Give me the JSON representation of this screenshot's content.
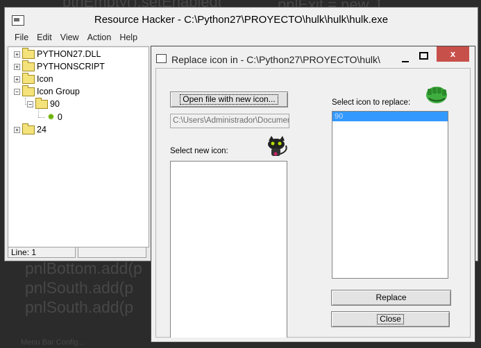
{
  "background_code": [
    "btnEmpty().setEnabled(",
    "pnlExit = new J",
    "pnlBottom.add(p",
    "pnlSouth.add(p",
    "pnlSouth.add(p",
    "Menu Bar Config..."
  ],
  "main_window": {
    "title": "Resource Hacker  -  C:\\Python27\\PROYECTO\\hulk\\hulk\\hulk.exe",
    "menu": [
      "File",
      "Edit",
      "View",
      "Action",
      "Help"
    ],
    "tree": [
      {
        "label": "PYTHON27.DLL",
        "expander": "+"
      },
      {
        "label": "PYTHONSCRIPT",
        "expander": "+"
      },
      {
        "label": "Icon",
        "expander": "+"
      },
      {
        "label": "Icon Group",
        "expander": "−"
      },
      {
        "label": "90",
        "expander": "−"
      },
      {
        "label": "0",
        "expander": ""
      },
      {
        "label": "24",
        "expander": "+"
      }
    ],
    "status": {
      "line": "Line: 1",
      "cell2": ""
    }
  },
  "dialog": {
    "title": "Replace icon in - C:\\Python27\\PROYECTO\\hulk\\",
    "open_button": "Open file with new icon...",
    "path_value": "C:\\Users\\Administrador\\Documents",
    "select_new_label": "Select new icon:",
    "select_replace_label": "Select icon to replace:",
    "replace_list": [
      "90"
    ],
    "replace_button": "Replace",
    "close_button": "Close",
    "close_glyph": "x"
  },
  "colors": {
    "selection": "#3399ff",
    "close_button": "#c7504a",
    "hulk_fist": "#3fae3f"
  }
}
